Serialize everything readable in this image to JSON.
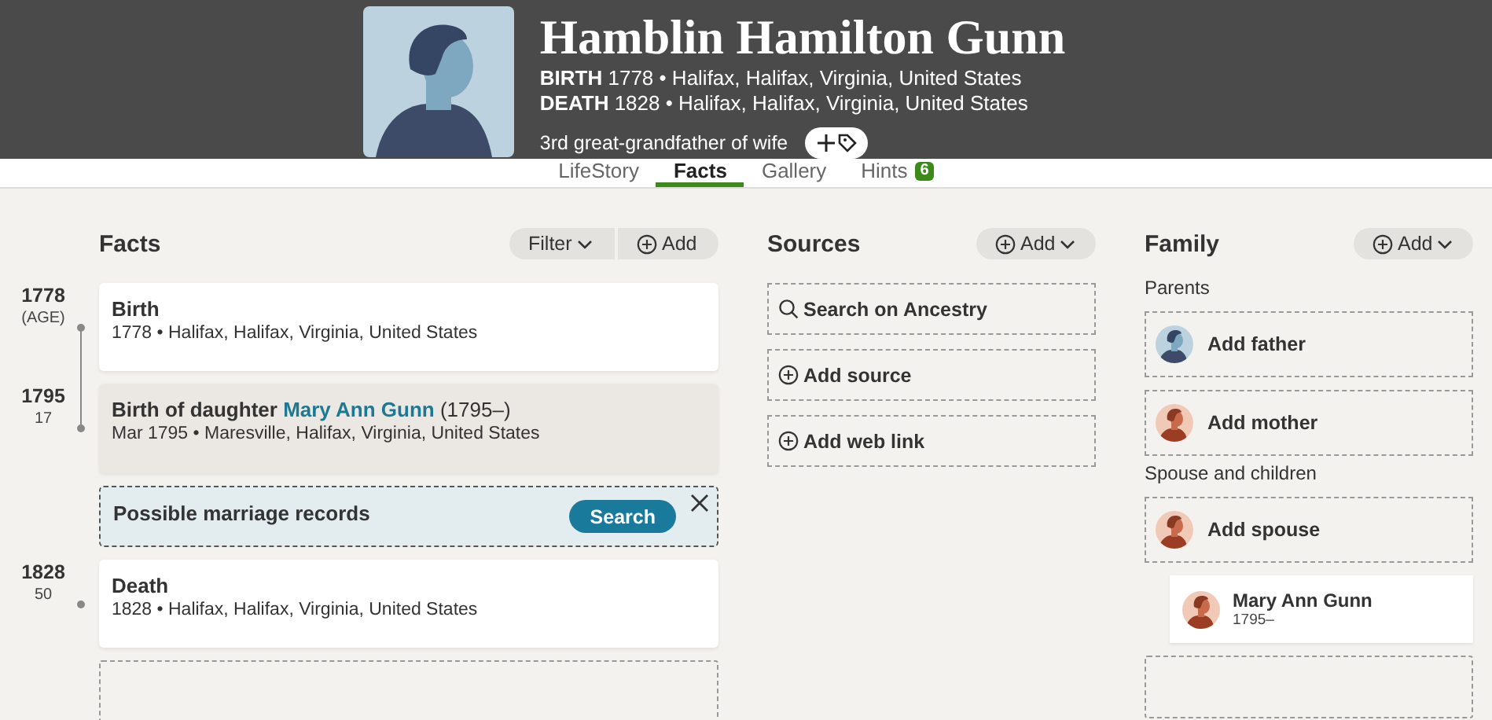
{
  "person": {
    "name": "Hamblin Hamilton Gunn",
    "events": [
      {
        "label": "BIRTH",
        "text": "1778 • Halifax, Halifax, Virginia, United States"
      },
      {
        "label": "DEATH",
        "text": "1828 • Halifax, Halifax, Virginia, United States"
      }
    ],
    "relation": "3rd great-grandfather of wife"
  },
  "tabs": [
    {
      "label": "LifeStory",
      "selected": false
    },
    {
      "label": "Facts",
      "selected": true
    },
    {
      "label": "Gallery",
      "selected": false
    },
    {
      "label": "Hints",
      "selected": false,
      "badge": "6"
    }
  ],
  "facts": {
    "title": "Facts",
    "filter": "Filter",
    "add": "Add",
    "items": [
      {
        "kind": "event",
        "year": "1778",
        "age": "(AGE)",
        "title": "Birth",
        "detail": "1778 • Halifax, Halifax, Virginia, United States",
        "highlighted": false
      },
      {
        "kind": "event",
        "year": "1795",
        "age": "17",
        "title": "Birth of daughter",
        "link": "Mary Ann Gunn",
        "suffix": "(1795–)",
        "detail": "Mar 1795 • Maresville, Halifax, Virginia, United States",
        "highlighted": true
      },
      {
        "kind": "hint",
        "title": "Possible marriage records",
        "button": "Search"
      },
      {
        "kind": "event",
        "year": "1828",
        "age": "50",
        "title": "Death",
        "detail": "1828 • Halifax, Halifax, Virginia, United States",
        "highlighted": false
      }
    ]
  },
  "sources": {
    "title": "Sources",
    "add": "Add",
    "items": [
      {
        "kind": "search",
        "label": "Search on Ancestry"
      },
      {
        "kind": "add",
        "label": "Add source"
      },
      {
        "kind": "add",
        "label": "Add web link"
      }
    ]
  },
  "family": {
    "title": "Family",
    "add": "Add",
    "sections": [
      {
        "label": "Parents",
        "items": [
          {
            "kind": "add",
            "label": "Add father"
          },
          {
            "kind": "add",
            "label": "Add mother"
          }
        ]
      },
      {
        "label": "Spouse and children",
        "items": [
          {
            "kind": "add",
            "label": "Add spouse"
          },
          {
            "kind": "person",
            "label": "Mary Ann Gunn",
            "dates": "1795–"
          }
        ]
      }
    ]
  }
}
